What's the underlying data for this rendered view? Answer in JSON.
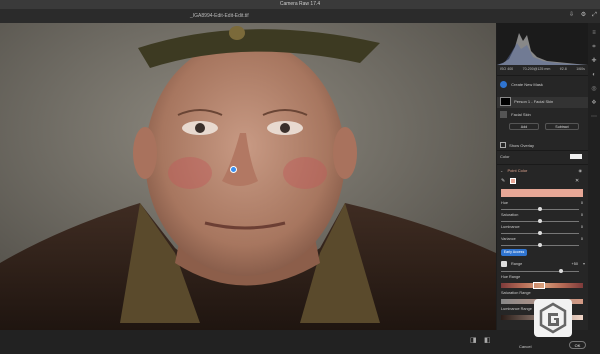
{
  "window": {
    "title": "Camera Raw 17.4"
  },
  "document": {
    "filename": "_IGA8994-Edit-Edit-Edit.tif"
  },
  "camera_info": {
    "iso": "ISO 400",
    "lens": "70-200@125 mm",
    "aperture": "f/2.8",
    "shutter": "1/60s"
  },
  "masks": {
    "create_new_mask": "Create New Mask",
    "mask_name": "Person 1 - Facial Skin",
    "component": "Facial Skin",
    "add_label": "Add",
    "subtract_label": "Subtract",
    "show_overlay": "Show Overlay"
  },
  "color_row": {
    "label": "Color"
  },
  "point_color": {
    "title": "Point Color",
    "sliders": [
      {
        "label": "Hue",
        "value": "0"
      },
      {
        "label": "Saturation",
        "value": "0"
      },
      {
        "label": "Luminance",
        "value": "0"
      },
      {
        "label": "Variance",
        "value": "0"
      }
    ],
    "early_access": "Early Access",
    "range_label": "Range",
    "range_value": "+50",
    "hue_range": "Hue Range",
    "saturation_range": "Saturation Range",
    "luminance_range": "Luminance Range"
  },
  "footer": {
    "cancel": "Cancel",
    "ok": "OK"
  },
  "colors": {
    "accent": "#2f74d0",
    "swatch": "#e7a796",
    "panel": "#262626"
  }
}
